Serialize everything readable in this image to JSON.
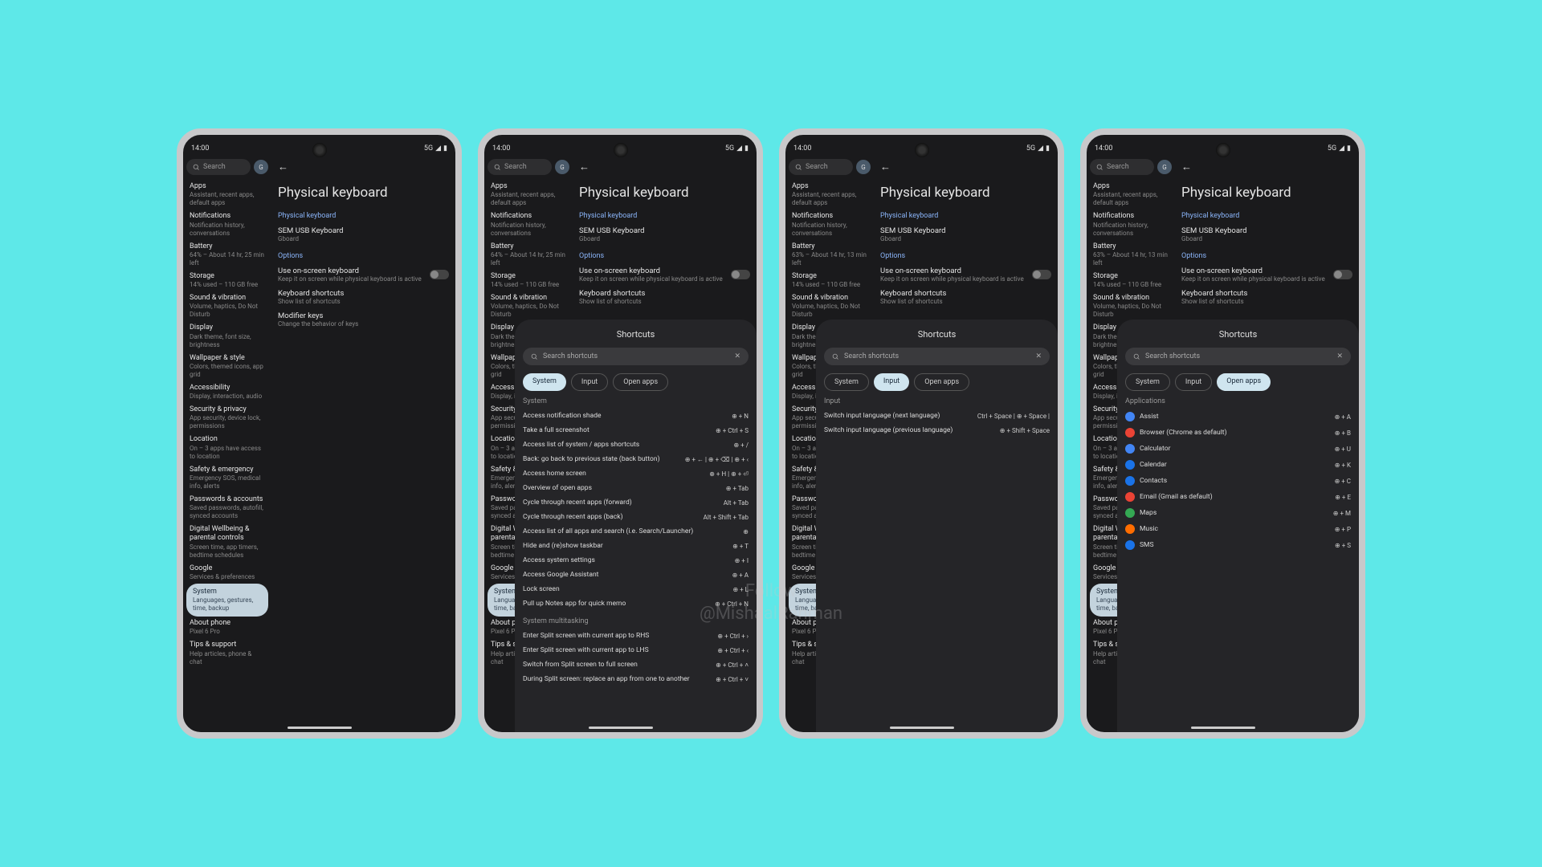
{
  "statusbar": {
    "time": "14:00",
    "net": "5G",
    "signal": "◢",
    "batt": "▮"
  },
  "search": {
    "placeholder": "Search",
    "avatar": "G"
  },
  "sidebar_full": [
    {
      "t": "Apps",
      "s": "Assistant, recent apps, default apps"
    },
    {
      "t": "Notifications",
      "s": "Notification history, conversations"
    },
    {
      "t": "Battery",
      "s": "64% – About 14 hr, 25 min left"
    },
    {
      "t": "Storage",
      "s": "14% used – 110 GB free"
    },
    {
      "t": "Sound & vibration",
      "s": "Volume, haptics, Do Not Disturb"
    },
    {
      "t": "Display",
      "s": "Dark theme, font size, brightness"
    },
    {
      "t": "Wallpaper & style",
      "s": "Colors, themed icons, app grid"
    },
    {
      "t": "Accessibility",
      "s": "Display, interaction, audio"
    },
    {
      "t": "Security & privacy",
      "s": "App security, device lock, permissions"
    },
    {
      "t": "Location",
      "s": "On – 3 apps have access to location"
    },
    {
      "t": "Safety & emergency",
      "s": "Emergency SOS, medical info, alerts"
    },
    {
      "t": "Passwords & accounts",
      "s": "Saved passwords, autofill, synced accounts"
    },
    {
      "t": "Digital Wellbeing & parental controls",
      "s": "Screen time, app timers, bedtime schedules"
    },
    {
      "t": "Google",
      "s": "Services & preferences"
    },
    {
      "t": "System",
      "s": "Languages, gestures, time, backup",
      "selected": true
    },
    {
      "t": "About phone",
      "s": "Pixel 6 Pro"
    },
    {
      "t": "Tips & support",
      "s": "Help articles, phone & chat"
    }
  ],
  "sidebar_alt_battery": {
    "t": "Battery",
    "s": "63% – About 14 hr, 13 min left"
  },
  "main": {
    "back": "←",
    "title": "Physical keyboard",
    "sec1": "Physical keyboard",
    "kbd_name": "SEM USB Keyboard",
    "kbd_sub": "Gboard",
    "sec2": "Options",
    "opt1": {
      "t": "Use on-screen keyboard",
      "s": "Keep it on screen while physical keyboard is active"
    },
    "opt2": {
      "t": "Keyboard shortcuts",
      "s": "Show list of shortcuts"
    },
    "opt3": {
      "t": "Modifier keys",
      "s": "Change the behavior of keys"
    }
  },
  "shortcuts": {
    "title": "Shortcuts",
    "search_placeholder": "Search shortcuts",
    "tabs": [
      "System",
      "Input",
      "Open apps"
    ],
    "system_header": "System",
    "system_list": [
      {
        "l": "Access notification shade",
        "k": "⊕ + N"
      },
      {
        "l": "Take a full screenshot",
        "k": "⊕ + Ctrl + S"
      },
      {
        "l": "Access list of system / apps shortcuts",
        "k": "⊕ + /"
      },
      {
        "l": "Back: go back to previous state (back button)",
        "k": "⊕ + ← | ⊕ + ⌫ | ⊕ + ‹"
      },
      {
        "l": "Access home screen",
        "k": "⊕ + H | ⊕ + ⏎"
      },
      {
        "l": "Overview of open apps",
        "k": "⊕ + Tab"
      },
      {
        "l": "Cycle through recent apps (forward)",
        "k": "Alt + Tab"
      },
      {
        "l": "Cycle through recent apps (back)",
        "k": "Alt + Shift + Tab"
      },
      {
        "l": "Access list of all apps and search (i.e. Search/Launcher)",
        "k": "⊕"
      },
      {
        "l": "Hide and (re)show taskbar",
        "k": "⊕ + T"
      },
      {
        "l": "Access system settings",
        "k": "⊕ + I"
      },
      {
        "l": "Access Google Assistant",
        "k": "⊕ + A"
      },
      {
        "l": "Lock screen",
        "k": "⊕ + L"
      },
      {
        "l": "Pull up Notes app for quick memo",
        "k": "⊕ + Ctrl + N"
      }
    ],
    "multitask_header": "System multitasking",
    "multitask_list": [
      {
        "l": "Enter Split screen with current app to RHS",
        "k": "⊕ + Ctrl + ›"
      },
      {
        "l": "Enter Split screen with current app to LHS",
        "k": "⊕ + Ctrl + ‹"
      },
      {
        "l": "Switch from Split screen to full screen",
        "k": "⊕ + Ctrl + ˄"
      },
      {
        "l": "During Split screen: replace an app from one to another",
        "k": "⊕ + Ctrl + ˅"
      }
    ],
    "input_header": "Input",
    "input_list": [
      {
        "l": "Switch input language (next language)",
        "k": "Ctrl + Space | ⊕ + Space |"
      },
      {
        "l": "Switch input language (previous language)",
        "k": "⊕ + Shift + Space"
      }
    ],
    "apps_header": "Applications",
    "apps_list": [
      {
        "l": "Assist",
        "k": "⊕ + A",
        "c": "#4285f4"
      },
      {
        "l": "Browser (Chrome as default)",
        "k": "⊕ + B",
        "c": "#ea4335"
      },
      {
        "l": "Calculator",
        "k": "⊕ + U",
        "c": "#4285f4"
      },
      {
        "l": "Calendar",
        "k": "⊕ + K",
        "c": "#1a73e8"
      },
      {
        "l": "Contacts",
        "k": "⊕ + C",
        "c": "#1a73e8"
      },
      {
        "l": "Email (Gmail as default)",
        "k": "⊕ + E",
        "c": "#ea4335"
      },
      {
        "l": "Maps",
        "k": "⊕ + M",
        "c": "#34a853"
      },
      {
        "l": "Music",
        "k": "⊕ + P",
        "c": "#ff6d00"
      },
      {
        "l": "SMS",
        "k": "⊕ + S",
        "c": "#1a73e8"
      }
    ]
  },
  "watermark": "Follow\n@MishaalRahman"
}
